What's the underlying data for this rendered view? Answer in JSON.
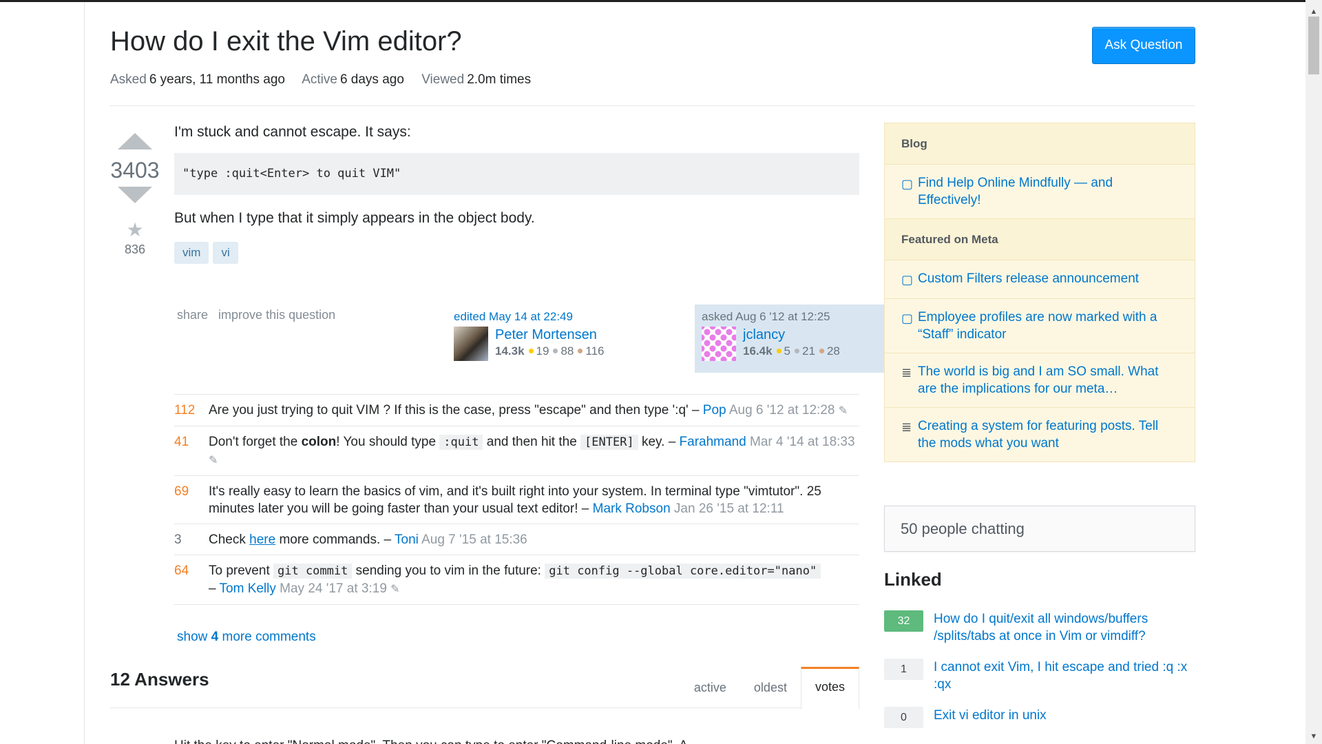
{
  "question": {
    "title": "How do I exit the Vim editor?",
    "ask_button": "Ask Question",
    "meta": {
      "asked_label": "Asked",
      "asked_value": "6 years, 11 months ago",
      "active_label": "Active",
      "active_value": "6 days ago",
      "viewed_label": "Viewed",
      "viewed_value": "2.0m times"
    },
    "votes": "3403",
    "favorites": "836",
    "body_p1": "I'm stuck and cannot escape. It says:",
    "code": "\"type :quit<Enter> to quit VIM\"",
    "body_p2": "But when I type that it simply appears in the object body.",
    "tags": [
      "vim",
      "vi"
    ],
    "menu": {
      "share": "share",
      "improve": "improve this question"
    },
    "edited": {
      "action": "edited May 14 at 22:49",
      "name": "Peter Mortensen",
      "rep": "14.3k",
      "gold": "19",
      "silver": "88",
      "bronze": "116"
    },
    "asked": {
      "action": "asked Aug 6 '12 at 12:25",
      "name": "jclancy",
      "rep": "16.4k",
      "gold": "5",
      "silver": "21",
      "bronze": "28"
    }
  },
  "comments": [
    {
      "score": "112",
      "text": "Are you just trying to quit VIM ? If this is the case, press \"escape\" and then type ':q'",
      "sep": " – ",
      "user": "Pop",
      "date": "Aug 6 '12 at 12:28"
    },
    {
      "score": "41",
      "t1": "Don't forget the ",
      "bold": "colon",
      "t2": "! You should type ",
      "code1": ":quit",
      "t3": " and then hit the ",
      "code2": "[ENTER]",
      "t4": " key.",
      "sep": " – ",
      "user": "Farahmand",
      "date": "Mar 4 '14 at 18:33"
    },
    {
      "score": "69",
      "text": "It's really easy to learn the basics of vim, and it's built right into your system. In terminal type \"vimtutor\". 25 minutes later you will be going faster than your usual text editor!",
      "sep": " – ",
      "user": "Mark Robson",
      "date": "Jan 26 '15 at 12:11"
    },
    {
      "score": "3",
      "t1": "Check ",
      "link": "here",
      "t2": " more commands.",
      "sep": " – ",
      "user": "Toni",
      "date": "Aug 7 '15 at 15:36"
    },
    {
      "score": "64",
      "t1": "To prevent ",
      "code1": "git commit",
      "t2": " sending you to vim in the future: ",
      "code2": "git config --global core.editor=\"nano\"",
      "sep": " – ",
      "user": "Tom Kelly",
      "date": "May 24 '17 at 3:19"
    }
  ],
  "show_more": {
    "prefix": "show ",
    "count": "4",
    "suffix": " more comments"
  },
  "answers": {
    "count_label": "12 Answers",
    "tabs": [
      "active",
      "oldest",
      "votes"
    ],
    "peek": "Hit the      key to enter \"Normal mode\". Then you can type    to enter \"Command-line mode\". A"
  },
  "sidebar": {
    "blog_header": "Blog",
    "blog_items": [
      "Find Help Online Mindfully — and Effectively!"
    ],
    "meta_header": "Featured on Meta",
    "meta_items": [
      "Custom Filters release announcement",
      "Employee profiles are now marked with a “Staff” indicator",
      "The world is big and I am SO small. What are the implications for our meta…",
      "Creating a system for featuring posts. Tell the mods what you want"
    ],
    "chat": "50 people chatting",
    "linked_title": "Linked",
    "linked": [
      {
        "score": "32",
        "title": "How do I quit/exit all windows/buffers /splits/tabs at once in Vim or vimdiff?"
      },
      {
        "score": "1",
        "title": "I cannot exit Vim, I hit escape and tried :q :x :qx"
      },
      {
        "score": "0",
        "title": "Exit vi editor in unix"
      }
    ]
  },
  "colors": {
    "accent": "#0a95ff",
    "link": "#0077cc",
    "comment_score": "#f48024",
    "accepted": "#5eba7d"
  },
  "icons": {
    "vote_up": "triangle-up",
    "vote_down": "triangle-down",
    "favorite": "star",
    "blog": "speech-bubble",
    "meta": "stack-logo",
    "edit": "pencil"
  }
}
